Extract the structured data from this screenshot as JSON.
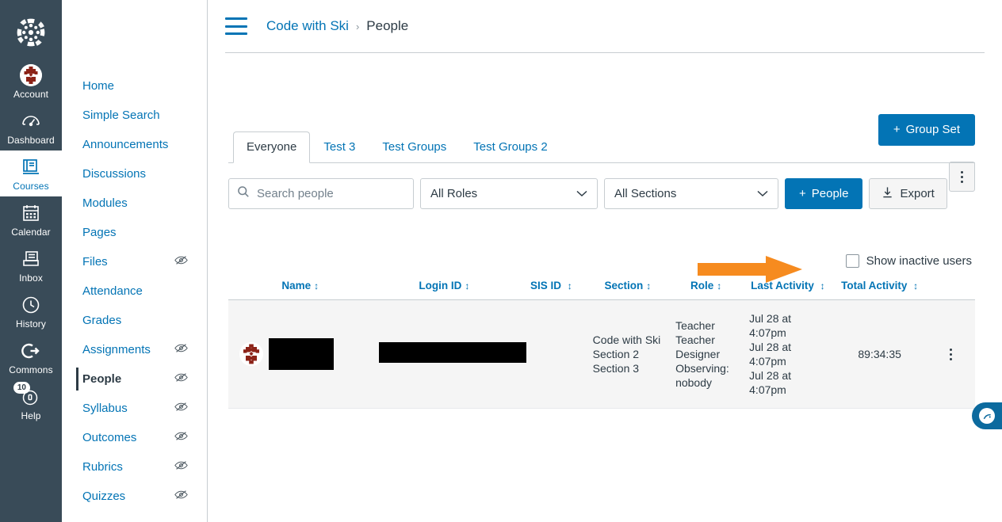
{
  "colors": {
    "brand_blue": "#0374B5",
    "nav_dark": "#394B58",
    "annotation_orange": "#F68B1F",
    "row_gray": "#F5F5F5",
    "text_dark": "#2D3B45"
  },
  "global_nav": {
    "logo_name": "canvas-logo",
    "items": [
      {
        "label": "Account",
        "icon": "user-avatar-icon",
        "active": false,
        "badge": null
      },
      {
        "label": "Dashboard",
        "icon": "dashboard-icon",
        "active": false,
        "badge": null
      },
      {
        "label": "Courses",
        "icon": "courses-icon",
        "active": true,
        "badge": null
      },
      {
        "label": "Calendar",
        "icon": "calendar-icon",
        "active": false,
        "badge": null
      },
      {
        "label": "Inbox",
        "icon": "inbox-icon",
        "active": false,
        "badge": null
      },
      {
        "label": "History",
        "icon": "clock-icon",
        "active": false,
        "badge": null
      },
      {
        "label": "Commons",
        "icon": "commons-arrow-icon",
        "active": false,
        "badge": null
      },
      {
        "label": "Help",
        "icon": "help-icon",
        "active": false,
        "badge": "10"
      }
    ]
  },
  "course_nav": {
    "items": [
      {
        "label": "Home",
        "hidden": false,
        "active": false
      },
      {
        "label": "Simple Search",
        "hidden": false,
        "active": false
      },
      {
        "label": "Announcements",
        "hidden": false,
        "active": false
      },
      {
        "label": "Discussions",
        "hidden": false,
        "active": false
      },
      {
        "label": "Modules",
        "hidden": false,
        "active": false
      },
      {
        "label": "Pages",
        "hidden": false,
        "active": false
      },
      {
        "label": "Files",
        "hidden": true,
        "active": false
      },
      {
        "label": "Attendance",
        "hidden": false,
        "active": false
      },
      {
        "label": "Grades",
        "hidden": false,
        "active": false
      },
      {
        "label": "Assignments",
        "hidden": true,
        "active": false
      },
      {
        "label": "People",
        "hidden": true,
        "active": true
      },
      {
        "label": "Syllabus",
        "hidden": true,
        "active": false
      },
      {
        "label": "Outcomes",
        "hidden": true,
        "active": false
      },
      {
        "label": "Rubrics",
        "hidden": true,
        "active": false
      },
      {
        "label": "Quizzes",
        "hidden": true,
        "active": false
      }
    ]
  },
  "breadcrumb": {
    "course": "Code with Ski",
    "separator": "›",
    "current": "People"
  },
  "toolbar": {
    "kebab_label": "⋮",
    "group_set_label": "Group Set",
    "group_set_plus": "+"
  },
  "tabs": [
    {
      "label": "Everyone",
      "active": true
    },
    {
      "label": "Test 3",
      "active": false
    },
    {
      "label": "Test Groups",
      "active": false
    },
    {
      "label": "Test Groups 2",
      "active": false
    }
  ],
  "filters": {
    "search_placeholder": "Search people",
    "search_value": "",
    "search_icon": "search-icon",
    "roles_selected": "All Roles",
    "sections_selected": "All Sections",
    "chevron": "⌄",
    "people_button": "People",
    "people_plus": "+",
    "export_button": "Export",
    "export_icon": "download-icon"
  },
  "inactive_users": {
    "label": "Show inactive users",
    "checked": false,
    "annotation": "orange-arrow-pointing-right"
  },
  "table": {
    "sort_icon": "↕",
    "columns": [
      {
        "key": "name",
        "label": "Name",
        "sortable": true
      },
      {
        "key": "login_id",
        "label": "Login ID",
        "sortable": true
      },
      {
        "key": "sis_id",
        "label": "SIS ID",
        "sortable": true
      },
      {
        "key": "section",
        "label": "Section",
        "sortable": true
      },
      {
        "key": "role",
        "label": "Role",
        "sortable": true
      },
      {
        "key": "last_activity",
        "label": "Last Activity",
        "sortable": true
      },
      {
        "key": "total_activity",
        "label": "Total Activity",
        "sortable": true
      }
    ],
    "rows": [
      {
        "avatar": "identicon-avatar",
        "name": "",
        "name_redacted": true,
        "login_id": "",
        "login_id_redacted": true,
        "sis_id": "",
        "section": "Code with Ski\nSection 2\nSection 3",
        "role": "Teacher\nTeacher\nDesigner\nObserving: nobody",
        "last_activity": "Jul 28 at 4:07pm\nJul 28 at 4:07pm\nJul 28 at 4:07pm",
        "total_activity": "89:34:35",
        "menu_icon": "⋮"
      }
    ]
  },
  "float_widget": {
    "name": "accessibility-widget",
    "glyph": "✎"
  }
}
